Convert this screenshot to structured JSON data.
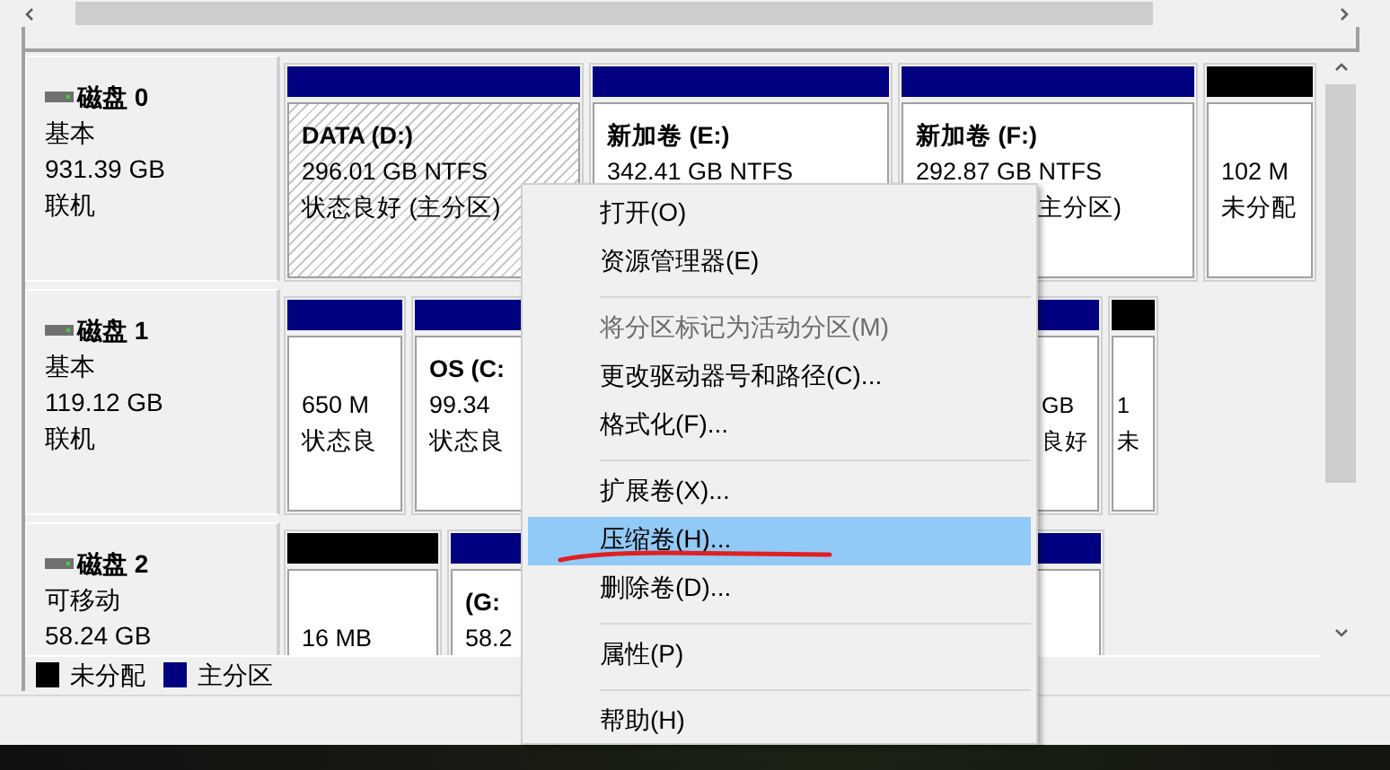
{
  "disks": [
    {
      "name": "磁盘 0",
      "type": "基本",
      "size": "931.39 GB",
      "status": "联机",
      "partitions": [
        {
          "kind": "primary",
          "selected": true,
          "title": "DATA  (D:)",
          "size": "296.01 GB NTFS",
          "status": "状态良好 (主分区)"
        },
        {
          "kind": "primary",
          "selected": false,
          "title": "新加卷  (E:)",
          "size": "342.41 GB NTFS"
        },
        {
          "kind": "primary",
          "selected": false,
          "title": "新加卷  (F:)",
          "size": "292.87 GB NTFS",
          "status": "主分区)"
        },
        {
          "kind": "unallocated",
          "selected": false,
          "size": "102 M",
          "status": "未分配"
        }
      ]
    },
    {
      "name": "磁盘 1",
      "type": "基本",
      "size": "119.12 GB",
      "status": "联机",
      "partitions": [
        {
          "kind": "primary",
          "selected": false,
          "size": "650 M",
          "status": "状态良"
        },
        {
          "kind": "primary",
          "selected": false,
          "title": "OS  (C:",
          "size": "99.34",
          "status": "状态良"
        },
        {
          "kind": "primary",
          "selected": false,
          "size": "GB",
          "status": "良好"
        },
        {
          "kind": "unallocated",
          "selected": false,
          "size": "1",
          "status": "未"
        }
      ]
    },
    {
      "name": "磁盘 2",
      "type": "可移动",
      "size": "58.24 GB",
      "partitions": [
        {
          "kind": "unallocated",
          "selected": false,
          "size": "16 MB"
        },
        {
          "kind": "primary",
          "selected": false,
          "title": "(G:",
          "size": "58.2"
        }
      ]
    }
  ],
  "legend": [
    {
      "kind": "unallocated",
      "label": "未分配"
    },
    {
      "kind": "primary",
      "label": "主分区"
    }
  ],
  "context_menu": [
    {
      "kind": "item",
      "label": "打开(O)",
      "disabled": false,
      "selected": false
    },
    {
      "kind": "item",
      "label": "资源管理器(E)",
      "disabled": false,
      "selected": false
    },
    {
      "kind": "separator"
    },
    {
      "kind": "item",
      "label": "将分区标记为活动分区(M)",
      "disabled": true,
      "selected": false
    },
    {
      "kind": "item",
      "label": "更改驱动器号和路径(C)...",
      "disabled": false,
      "selected": false
    },
    {
      "kind": "item",
      "label": "格式化(F)...",
      "disabled": false,
      "selected": false
    },
    {
      "kind": "separator"
    },
    {
      "kind": "item",
      "label": "扩展卷(X)...",
      "disabled": false,
      "selected": false
    },
    {
      "kind": "item",
      "label": "压缩卷(H)...",
      "disabled": false,
      "selected": true
    },
    {
      "kind": "item",
      "label": "删除卷(D)...",
      "disabled": false,
      "selected": false
    },
    {
      "kind": "separator"
    },
    {
      "kind": "item",
      "label": "属性(P)",
      "disabled": false,
      "selected": false
    },
    {
      "kind": "separator"
    },
    {
      "kind": "item",
      "label": "帮助(H)",
      "disabled": false,
      "selected": false
    }
  ]
}
